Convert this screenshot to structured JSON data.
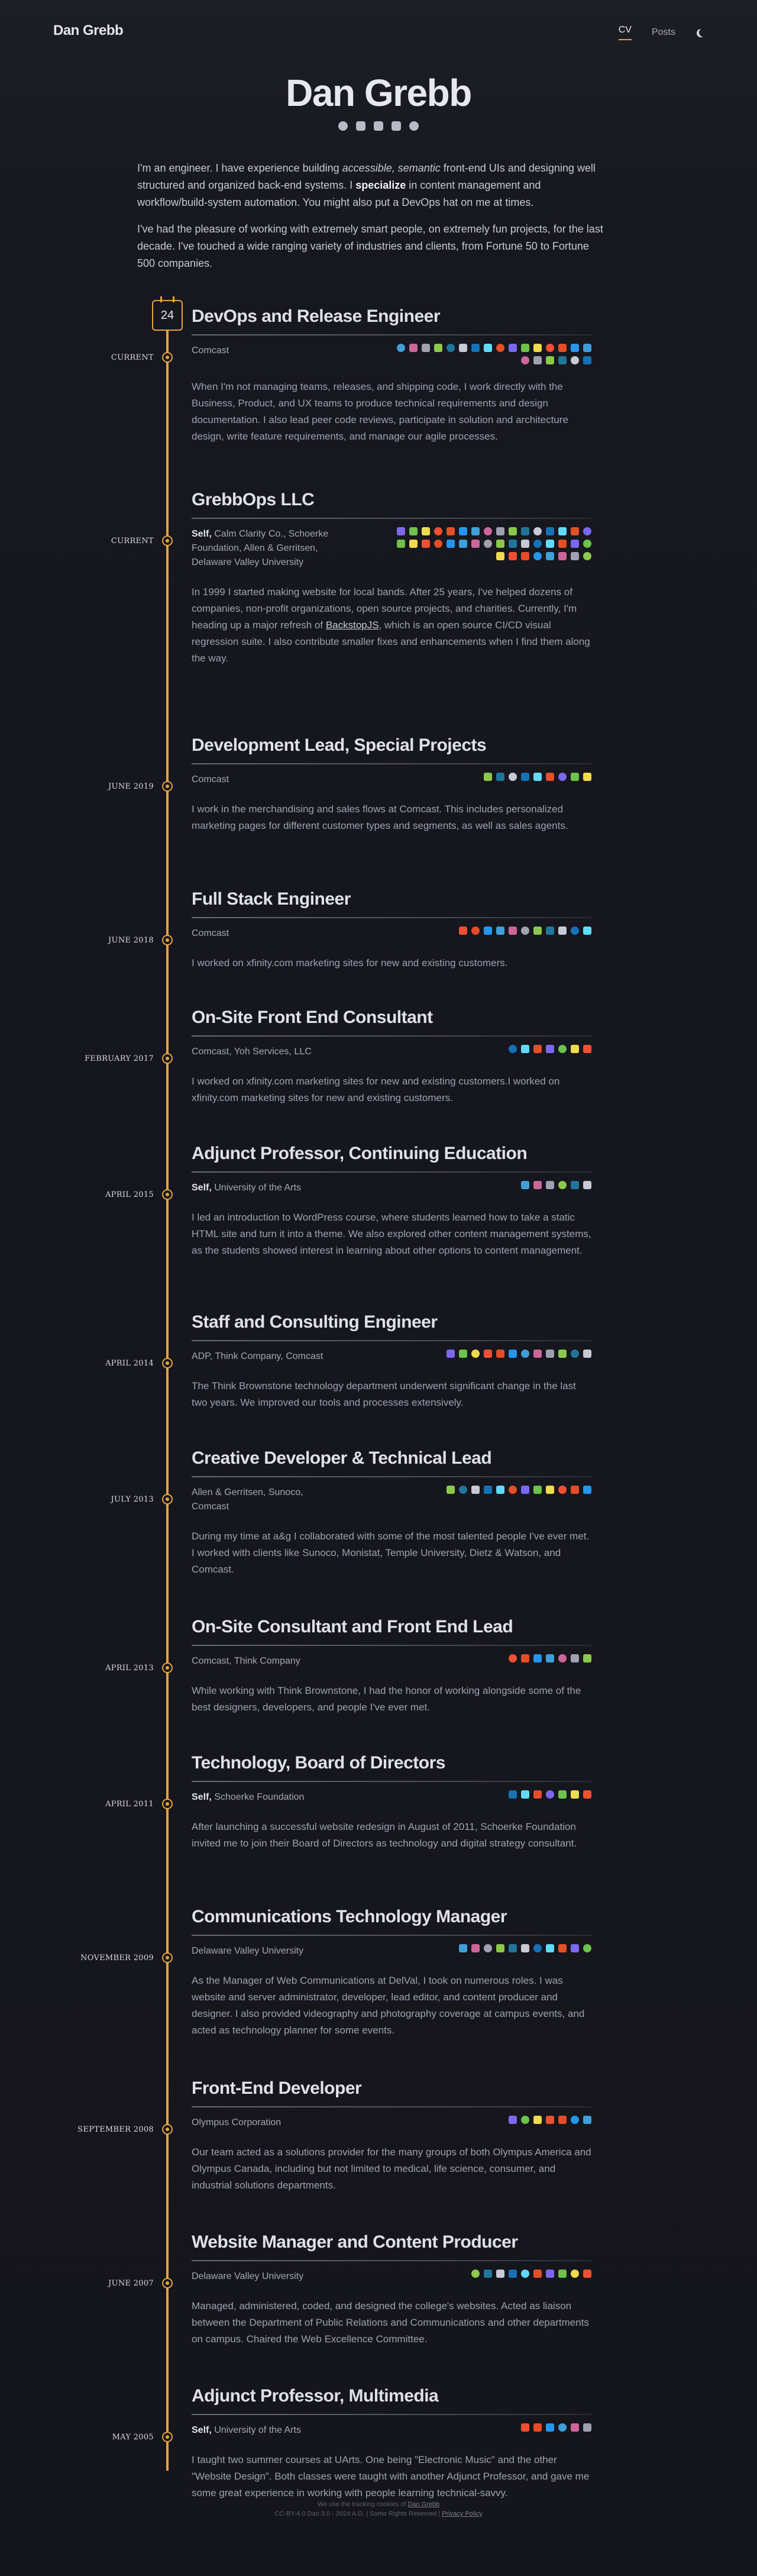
{
  "header": {
    "brand": "Dan Grebb",
    "nav": [
      "CV",
      "Posts"
    ]
  },
  "hero": {
    "name": "Dan Grebb",
    "socials": [
      "github-icon",
      "fire-icon",
      "linkedin-icon",
      "code-icon",
      "bird-icon"
    ]
  },
  "intro": {
    "p1_a": "I'm an engineer. I have experience building ",
    "p1_em": "accessible, semantic",
    "p1_b": " front-end UIs and designing well structured and organized back-end systems. I ",
    "p1_strong": "specialize",
    "p1_c": " in content management and workflow/build-system automation. You might also put a DevOps hat on me at times.",
    "p2": "I've had the pleasure of working with extremely smart people, on extremely fun projects, for the last decade. I've touched a wide ranging variety of industries and clients, from Fortune 50 to Fortune 500 companies."
  },
  "calendar_day": "24",
  "jobs": [
    {
      "date": "Current",
      "title": "DevOps and Release Engineer",
      "self": "",
      "companies": "Comcast",
      "desc": "When I'm not managing teams, releases, and shipping code, I work directly with the Business, Product, and UX teams to produce technical requirements and design documentation. I also lead peer code reviews, participate in solution and architecture design, write feature requirements, and manage our agile processes.",
      "icons": 22
    },
    {
      "date": "Current",
      "title": "GrebbOps LLC",
      "self": "Self,",
      "companies": "Calm Clarity Co., Schoerke Foundation, Allen & Gerritsen, Delaware Valley University",
      "desc_a": "In 1999 I started making website for local bands. After 25 years, I've helped dozens of companies, non-profit organizations, open source projects, and charities. Currently, I'm heading up a major refresh of ",
      "desc_link": "BackstopJS",
      "desc_b": ", which is an open source CI/CD visual regression suite. I also contribute smaller fixes and enhancements when I find them along the way.",
      "icons": 40
    },
    {
      "date": "June 2019",
      "title": "Development Lead, Special Projects",
      "self": "",
      "companies": "Comcast",
      "desc": "I work in the merchandising and sales flows at Comcast. This includes personalized marketing pages for different customer types and segments, as well as sales agents.",
      "icons": 9
    },
    {
      "date": "June 2018",
      "title": "Full Stack Engineer",
      "self": "",
      "companies": "Comcast",
      "desc": "I worked on xfinity.com marketing sites for new and existing customers.",
      "icons": 11
    },
    {
      "date": "February 2017",
      "title": "On-Site Front End Consultant",
      "self": "",
      "companies": "Comcast, Yoh Services, LLC",
      "desc": "I worked on xfinity.com marketing sites for new and existing customers.I worked on xfinity.com marketing sites for new and existing customers.",
      "icons": 7
    },
    {
      "date": "April 2015",
      "title": "Adjunct Professor, Continuing Education",
      "self": "Self,",
      "companies": "University of the Arts",
      "desc": "I led an introduction to WordPress course, where students learned how to take a static HTML site and turn it into a theme. We also explored other content management systems, as the students showed interest in learning about other options to content management.",
      "icons": 6
    },
    {
      "date": "April 2014",
      "title": "Staff and Consulting Engineer",
      "self": "",
      "companies": "ADP, Think Company, Comcast",
      "desc": "The Think Brownstone technology department underwent significant change in the last two years. We improved our tools and processes extensively.",
      "icons": 12
    },
    {
      "date": "July 2013",
      "title": "Creative Developer & Technical Lead",
      "self": "",
      "companies": "Allen & Gerritsen, Sunoco, Comcast",
      "desc": "During my time at a&g I collaborated with some of the most talented people I've ever met. I worked with clients like Sunoco, Monistat, Temple University, Dietz & Watson, and Comcast.",
      "icons": 12
    },
    {
      "date": "April 2013",
      "title": "On-Site Consultant and Front End Lead",
      "self": "",
      "companies": "Comcast, Think Company",
      "desc": "While working with Think Brownstone, I had the honor of working alongside some of the best designers, developers, and people I've ever met.",
      "icons": 7
    },
    {
      "date": "April 2011",
      "title": "Technology, Board of Directors",
      "self": "Self,",
      "companies": "Schoerke Foundation",
      "desc": "After launching a successful website redesign in August of 2011, Schoerke Foundation invited me to join their Board of Directors as technology and digital strategy consultant.",
      "icons": 7
    },
    {
      "date": "November 2009",
      "title": "Communications Technology Manager",
      "self": "",
      "companies": "Delaware Valley University",
      "desc": "As the Manager of Web Communications at DelVal, I took on numerous roles. I was website and server administrator, developer, lead editor, and content producer and designer. I also provided videography and photography coverage at campus events, and acted as technology planner for some events.",
      "icons": 11
    },
    {
      "date": "September 2008",
      "title": "Front-End Developer",
      "self": "",
      "companies": "Olympus Corporation",
      "desc": "Our team acted as a solutions provider for the many groups of both Olympus America and Olympus Canada, including but not limited to medical, life science, consumer, and industrial solutions departments.",
      "icons": 7
    },
    {
      "date": "June 2007",
      "title": "Website Manager and Content Producer",
      "self": "",
      "companies": "Delaware Valley University",
      "desc": "Managed, administered, coded, and designed the college's websites. Acted as liaison between the Department of Public Relations and Communications and other departments on campus. Chaired the Web Excellence Committee.",
      "icons": 10
    },
    {
      "date": "May 2005",
      "title": "Adjunct Professor, Multimedia",
      "self": "Self,",
      "companies": "University of the Arts",
      "desc": "I taught two summer courses at UArts. One being \"Electronic Music\" and the other \"Website Design\". Both classes were taught with another Adjunct Professor, and gave me some great experience in working with people learning technical-savvy.",
      "icons": 6
    }
  ],
  "footer": {
    "line1_a": "We use the tracking cookies of ",
    "line1_link": "Dan Grebb",
    "line2_a": "CC-BY-4.0 Dan 3.0 - 2024 A.D. | Some Rights Reserved | ",
    "line2_link": "Privacy Policy"
  },
  "colors": {
    "accent": "#e8a33b",
    "background": "#17171f",
    "icon_palette": [
      "#3f9fd8",
      "#e44d26",
      "#f0db4f",
      "#7b68ee",
      "#61dafb",
      "#c7c9d5",
      "#8cc84b",
      "#cc6699",
      "#2496ed",
      "#f05032",
      "#6cc24a",
      "#e34f26",
      "#1572b6",
      "#21759b",
      "#a0a0b0"
    ]
  }
}
